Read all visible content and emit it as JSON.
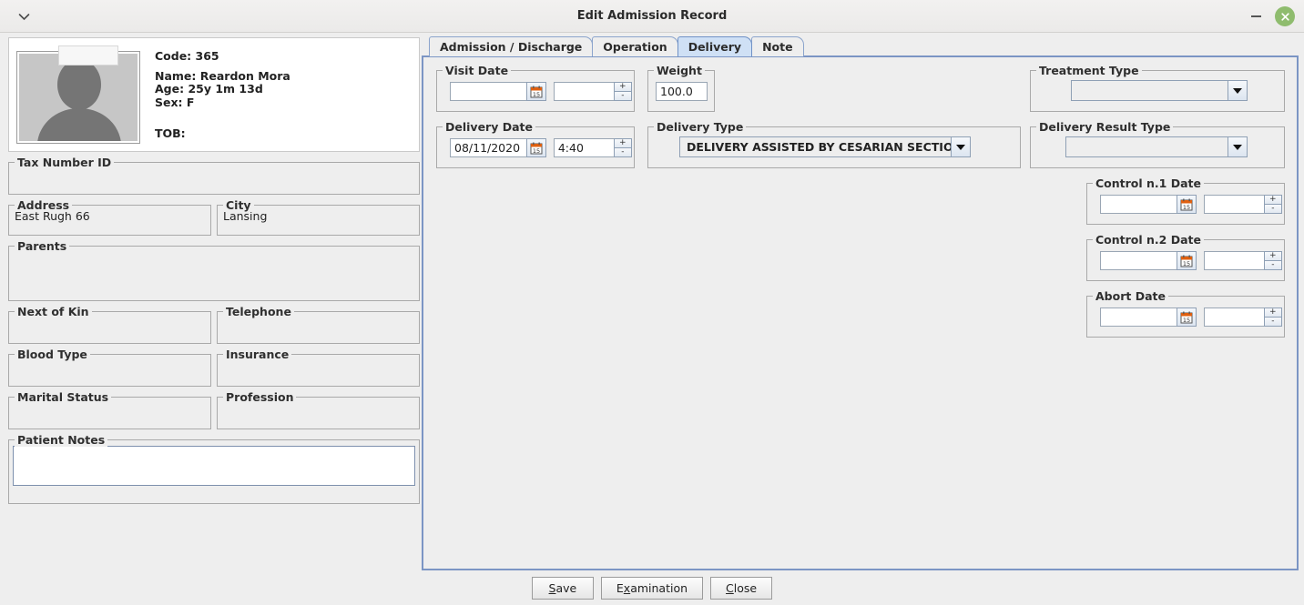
{
  "window": {
    "title": "Edit Admission Record",
    "menu_icon": "chevron-down-icon",
    "minimize_icon": "minimize-icon",
    "close_icon": "close-icon",
    "close_button_color": "#8fbc6e"
  },
  "patient": {
    "avatar_icon": "person-placeholder-icon",
    "code": "Code: 365",
    "name": "Name: Reardon Mora",
    "age": "Age: 25y 1m 13d",
    "sex": "Sex: F",
    "tob": "TOB:"
  },
  "left_fields": [
    {
      "label": "Tax Number ID",
      "value": ""
    },
    {
      "label": "Address",
      "value": "East Rugh 66"
    },
    {
      "label": "City",
      "value": "Lansing"
    },
    {
      "label": "Parents",
      "value": ""
    },
    {
      "label": "Next of Kin",
      "value": ""
    },
    {
      "label": "Telephone",
      "value": ""
    },
    {
      "label": "Blood Type",
      "value": ""
    },
    {
      "label": "Insurance",
      "value": ""
    },
    {
      "label": "Marital Status",
      "value": ""
    },
    {
      "label": "Profession",
      "value": ""
    },
    {
      "label": "Patient Notes",
      "value": ""
    }
  ],
  "tabs": [
    {
      "label": "Admission / Discharge",
      "selected": false
    },
    {
      "label": "Operation",
      "selected": false
    },
    {
      "label": "Delivery",
      "selected": true
    },
    {
      "label": "Note",
      "selected": false
    }
  ],
  "delivery": {
    "visit_date": {
      "label": "Visit Date",
      "date_value": "",
      "date_placeholder": "",
      "time_value": "",
      "calendar_icon": "calendar-icon",
      "spinner_up": "+",
      "spinner_down": "-"
    },
    "weight": {
      "label": "Weight",
      "value": "100.0"
    },
    "delivery_date": {
      "label": "Delivery Date",
      "date_value": "08/11/2020",
      "time_value": "4:40",
      "calendar_icon": "calendar-icon",
      "spinner_up": "+",
      "spinner_down": "-"
    },
    "delivery_type": {
      "label": "Delivery Type",
      "value": "DELIVERY ASSISTED BY CESARIAN SECTION"
    },
    "treatment_type": {
      "label": "Treatment Type",
      "value": ""
    },
    "delivery_result_type": {
      "label": "Delivery Result Type",
      "value": ""
    },
    "control1_date": {
      "label": "Control n.1 Date",
      "date_value": "",
      "time_value": "",
      "calendar_icon": "calendar-icon",
      "spinner_up": "+",
      "spinner_down": "-"
    },
    "control2_date": {
      "label": "Control n.2 Date",
      "date_value": "",
      "time_value": "",
      "calendar_icon": "calendar-icon",
      "spinner_up": "+",
      "spinner_down": "-"
    },
    "abort_date": {
      "label": "Abort Date",
      "date_value": "",
      "time_value": "",
      "calendar_icon": "calendar-icon",
      "spinner_up": "+",
      "spinner_down": "-"
    }
  },
  "buttons": {
    "save": {
      "pre": "",
      "mnemonic": "S",
      "post": "ave"
    },
    "examination": {
      "pre": "E",
      "mnemonic": "x",
      "post": "amination"
    },
    "close": {
      "pre": "",
      "mnemonic": "C",
      "post": "lose"
    }
  },
  "colors": {
    "window_bg": "#eeeeee",
    "panel_border": "#7b95c4",
    "tab_selected_bg": "#cfe0f5",
    "calendar_accent": "#e06010"
  }
}
